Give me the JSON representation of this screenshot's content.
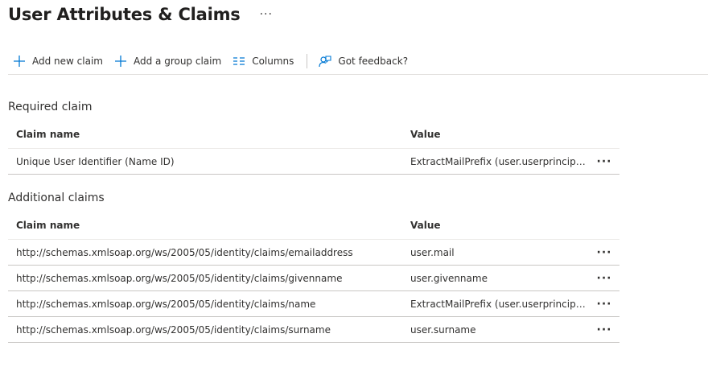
{
  "header": {
    "title": "User Attributes & Claims",
    "more": "···"
  },
  "toolbar": {
    "add_claim": "Add new claim",
    "add_group_claim": "Add a group claim",
    "columns": "Columns",
    "feedback": "Got feedback?"
  },
  "required": {
    "title": "Required claim",
    "col_name": "Claim name",
    "col_value": "Value",
    "rows": [
      {
        "name": "Unique User Identifier (Name ID)",
        "value": "ExtractMailPrefix (user.userprincipalname)",
        "more": "···"
      }
    ]
  },
  "additional": {
    "title": "Additional claims",
    "col_name": "Claim name",
    "col_value": "Value",
    "rows": [
      {
        "name": "http://schemas.xmlsoap.org/ws/2005/05/identity/claims/emailaddress",
        "value": "user.mail",
        "more": "···"
      },
      {
        "name": "http://schemas.xmlsoap.org/ws/2005/05/identity/claims/givenname",
        "value": "user.givenname",
        "more": "···"
      },
      {
        "name": "http://schemas.xmlsoap.org/ws/2005/05/identity/claims/name",
        "value": "ExtractMailPrefix (user.userprincipalname)",
        "more": "···"
      },
      {
        "name": "http://schemas.xmlsoap.org/ws/2005/05/identity/claims/surname",
        "value": "user.surname",
        "more": "···"
      }
    ]
  },
  "colors": {
    "accent": "#0078d4",
    "text": "#323130",
    "border": "#c8c6c4"
  }
}
